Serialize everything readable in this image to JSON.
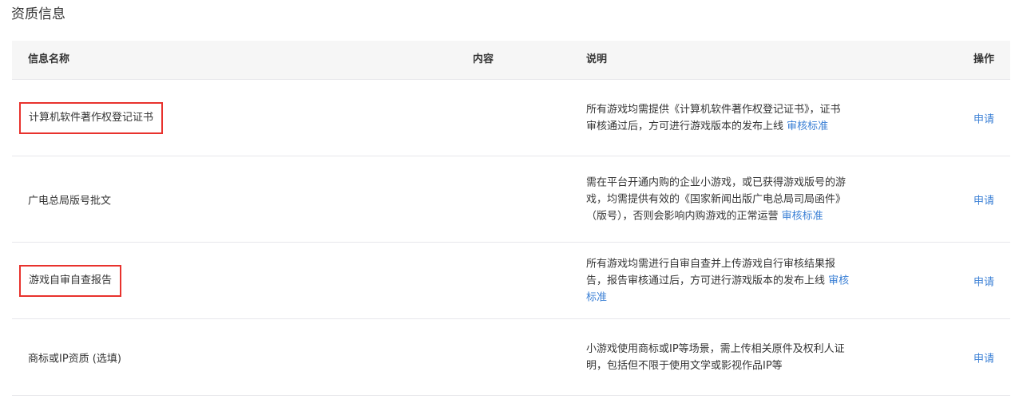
{
  "section": {
    "title": "资质信息"
  },
  "table": {
    "headers": {
      "name": "信息名称",
      "content": "内容",
      "desc": "说明",
      "op": "操作"
    },
    "rows": [
      {
        "name": "计算机软件著作权登记证书",
        "desc_text": "所有游戏均需提供《计算机软件著作权登记证书》，证书审核通过后，方可进行游戏版本的发布上线",
        "desc_link": "审核标准",
        "action": "申请",
        "highlighted": true
      },
      {
        "name": "广电总局版号批文",
        "desc_text": "需在平台开通内购的企业小游戏，或已获得游戏版号的游戏，均需提供有效的《国家新闻出版广电总局司局函件》（版号），否则会影响内购游戏的正常运营",
        "desc_link": "审核标准",
        "action": "申请",
        "highlighted": false
      },
      {
        "name": "游戏自审自查报告",
        "desc_text": "所有游戏均需进行自审自查并上传游戏自行审核结果报告，报告审核通过后，方可进行游戏版本的发布上线",
        "desc_link": "审核标准",
        "action": "申请",
        "highlighted": true
      },
      {
        "name": "商标或IP资质 (选填)",
        "desc_text": "小游戏使用商标或IP等场景，需上传相关原件及权利人证明，包括但不限于使用文学或影视作品IP等",
        "desc_link": "",
        "action": "申请",
        "highlighted": false
      }
    ]
  },
  "colors": {
    "link": "#3a7fd5",
    "highlight_border": "#e8322d",
    "header_bg": "#f6f6f6"
  }
}
